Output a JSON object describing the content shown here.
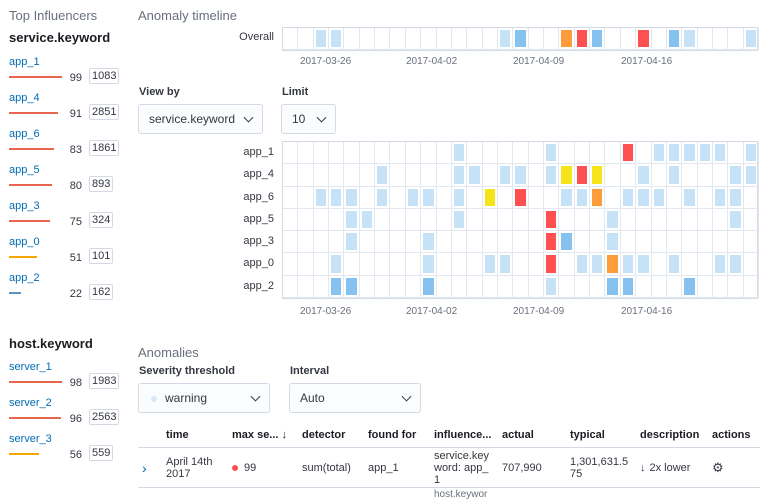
{
  "influencers": {
    "title": "Top Influencers",
    "groups": [
      {
        "field": "service.keyword",
        "items": [
          {
            "label": "app_1",
            "score": "99",
            "count": "1083",
            "level": 0.99,
            "color": "#e7664c"
          },
          {
            "label": "app_4",
            "score": "91",
            "count": "2851",
            "level": 0.91,
            "color": "#e7664c"
          },
          {
            "label": "app_6",
            "score": "83",
            "count": "1861",
            "level": 0.83,
            "color": "#e7664c"
          },
          {
            "label": "app_5",
            "score": "80",
            "count": "893",
            "level": 0.8,
            "color": "#e7664c"
          },
          {
            "label": "app_3",
            "score": "75",
            "count": "324",
            "level": 0.75,
            "color": "#e7664c"
          },
          {
            "label": "app_0",
            "score": "51",
            "count": "101",
            "level": 0.51,
            "color": "#f5a700"
          },
          {
            "label": "app_2",
            "score": "22",
            "count": "162",
            "level": 0.22,
            "color": "#6092c0"
          }
        ]
      },
      {
        "field": "host.keyword",
        "items": [
          {
            "label": "server_1",
            "score": "98",
            "count": "1983",
            "level": 0.98,
            "color": "#e7664c"
          },
          {
            "label": "server_2",
            "score": "96",
            "count": "2563",
            "level": 0.96,
            "color": "#e7664c"
          },
          {
            "label": "server_3",
            "score": "56",
            "count": "559",
            "level": 0.56,
            "color": "#f5a700"
          }
        ]
      }
    ]
  },
  "timeline": {
    "title": "Anomaly timeline",
    "overall_label": "Overall",
    "axis_ticks": [
      "2017-03-26",
      "2017-04-02",
      "2017-04-09",
      "2017-04-16"
    ],
    "view_by_label": "View by",
    "view_by_value": "service.keyword",
    "limit_label": "Limit",
    "limit_value": "10",
    "lane_labels": [
      "app_1",
      "app_4",
      "app_6",
      "app_5",
      "app_3",
      "app_0",
      "app_2"
    ]
  },
  "anomalies": {
    "title": "Anomalies",
    "severity_label": "Severity threshold",
    "severity_value": "warning",
    "interval_label": "Interval",
    "interval_value": "Auto",
    "columns": {
      "time": "time",
      "max_severity": "max se...",
      "detector": "detector",
      "found_for": "found for",
      "influencers": "influence...",
      "actual": "actual",
      "typical": "typical",
      "description": "description",
      "actions": "actions"
    },
    "rows": [
      {
        "time": "April 14th 2017",
        "severity": "99",
        "detector": "sum(total)",
        "found_for": "app_1",
        "influencers": "service.keyword: app_1",
        "actual": "707,990",
        "typical": "1,301,631.575",
        "description": "2x lower"
      }
    ],
    "next_row_partial": "host.keywor"
  }
}
